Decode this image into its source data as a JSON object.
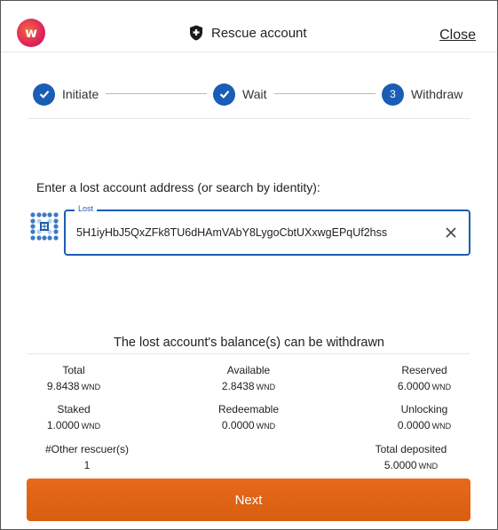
{
  "header": {
    "logo_letter": "w",
    "title": "Rescue account",
    "close_label": "Close",
    "shield_icon": "shield-icon"
  },
  "steps": [
    {
      "label": "Initiate",
      "state": "done"
    },
    {
      "label": "Wait",
      "state": "done"
    },
    {
      "label": "Withdraw",
      "state": "active",
      "number": "3"
    }
  ],
  "form": {
    "prompt": "Enter a lost account address (or search by identity):",
    "field_legend": "Lost",
    "address_value": "5H1iyHbJ5QxZFk8TU6dHAmVAbY8LygoCbtUXxwgEPqUf2hss"
  },
  "balances": {
    "title": "The lost account's balance(s) can be withdrawn",
    "unit": "WND",
    "total_label": "Total",
    "total_value": "9.8438",
    "available_label": "Available",
    "available_value": "2.8438",
    "reserved_label": "Reserved",
    "reserved_value": "6.0000",
    "staked_label": "Staked",
    "staked_value": "1.0000",
    "redeemable_label": "Redeemable",
    "redeemable_value": "0.0000",
    "unlocking_label": "Unlocking",
    "unlocking_value": "0.0000",
    "rescuers_label": "#Other rescuer(s)",
    "rescuers_value": "1",
    "deposited_label": "Total deposited",
    "deposited_value": "5.0000"
  },
  "footer": {
    "next_label": "Next"
  },
  "colors": {
    "accent_blue": "#1a5db5",
    "button_orange": "#e0621a",
    "logo_pink": "#e0245e"
  }
}
